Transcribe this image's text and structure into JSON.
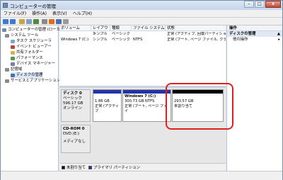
{
  "window": {
    "title": "コンピューターの管理"
  },
  "menu": [
    "ファイル(F)",
    "操作(A)",
    "表示(V)",
    "ヘルプ(H)"
  ],
  "tree": {
    "root": "コンピューターの管理 (ローカル)",
    "items": [
      "システム ツール",
      "タスク スケジューラ",
      "イベント ビューアー",
      "共有フォルダー",
      "パフォーマンス",
      "デバイス マネージャー",
      "記憶域",
      "ディスクの管理",
      "サービスとアプリケーション"
    ]
  },
  "volumes": {
    "headers": [
      "ボリューム",
      "レイアウト",
      "種類",
      "ファイル システム",
      "状態"
    ],
    "rows": [
      [
        "",
        "シンプル",
        "ベーシック",
        "",
        "正常 (アクティブ, 回復パーティション)"
      ],
      [
        "Windows 7 (C:)",
        "シンプル",
        "ベーシック",
        "NTFS",
        "正常 (ブート, ページ ファイル, クラッシュ"
      ]
    ]
  },
  "disks": [
    {
      "name": "ディスク 0",
      "type": "ベーシック",
      "size": "596.17 GB",
      "status": "オンライン",
      "partitions": [
        {
          "title": "",
          "size": "1.86 GB",
          "status": "正常 (アクティブ"
        },
        {
          "title": "Windows 7 (C:)",
          "size": "300.73 GB NTFS",
          "status": "正常 (ブート, ページ ファイ"
        },
        {
          "title": "",
          "size": "293.57 GB",
          "status": "未割り当て"
        }
      ]
    },
    {
      "name": "CD-ROM 0",
      "type": "DVD (E:)",
      "size": "",
      "status": "メディアなし"
    }
  ],
  "legend": [
    "未割り当て",
    "プライマリ パーティション"
  ],
  "actions": {
    "header": "操作",
    "section": "ディスクの管理",
    "item": "他の操作"
  },
  "colors": {
    "accent": "#1e3c8c",
    "unallocated": "#000000",
    "primary": "#2233aa",
    "highlight": "#e02020"
  }
}
